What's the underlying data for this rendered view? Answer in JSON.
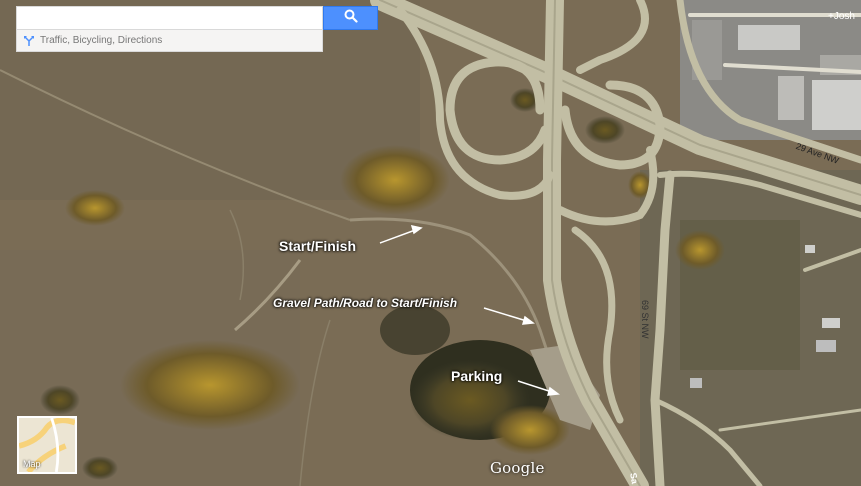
{
  "search": {
    "value": "",
    "placeholder": ""
  },
  "subbar": {
    "text": "Traffic, Bicycling, Directions"
  },
  "user": {
    "name": "+Josh"
  },
  "roads": {
    "avenue": "29 Ave NW",
    "street": "69 St NW",
    "partial": "Sa"
  },
  "annotations": {
    "start_finish": "Start/Finish",
    "gravel_path": "Gravel Path/Road to Start/Finish",
    "parking": "Parking"
  },
  "map_toggle": {
    "label": "Map"
  },
  "branding": {
    "logo_text": "Google"
  },
  "colors": {
    "search_button": "#4d90fe",
    "annotation_text": "#ffffff",
    "road": "#b9b59a",
    "grass": "#7a6d55"
  }
}
